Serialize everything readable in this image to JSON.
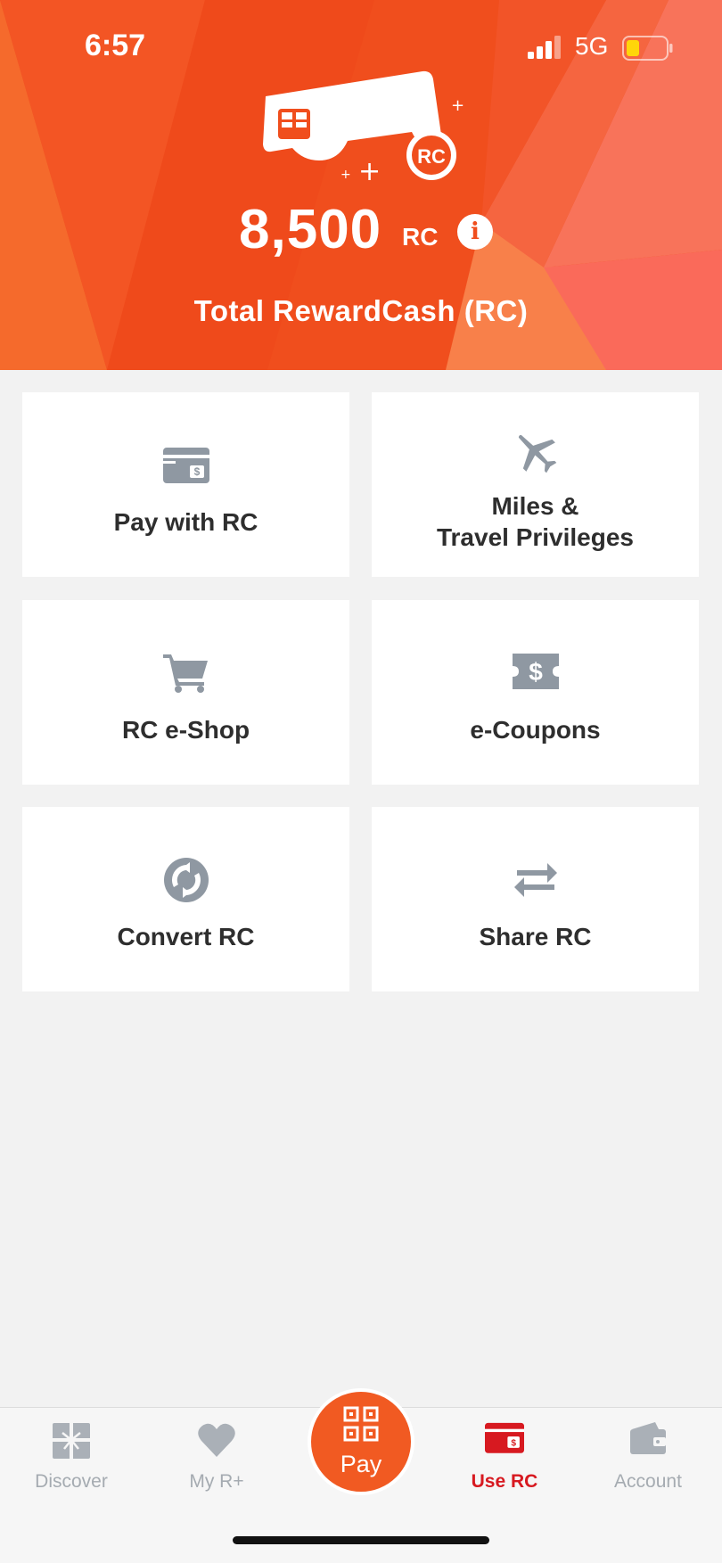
{
  "status_bar": {
    "time": "6:57",
    "network": "5G"
  },
  "header": {
    "card_badge": "RC",
    "balance_value": "8,500",
    "balance_unit": "RC",
    "info_icon_glyph": "i",
    "caption": "Total RewardCash (RC)"
  },
  "tiles": [
    {
      "label": "Pay with RC",
      "icon": "wallet-icon"
    },
    {
      "label_line1": "Miles &",
      "label_line2": "Travel Privileges",
      "icon": "airplane-icon"
    },
    {
      "label": "RC e-Shop",
      "icon": "shopping-cart-icon"
    },
    {
      "label": "e-Coupons",
      "icon": "ticket-icon"
    },
    {
      "label": "Convert RC",
      "icon": "convert-icon"
    },
    {
      "label": "Share RC",
      "icon": "swap-arrows-icon"
    }
  ],
  "tabbar": {
    "items": [
      {
        "label": "Discover",
        "icon": "gift-icon"
      },
      {
        "label": "My R+",
        "icon": "heart-icon"
      },
      {
        "label": "Pay",
        "icon": "qr-code-icon"
      },
      {
        "label": "Use RC",
        "icon": "wallet-icon",
        "active": true
      },
      {
        "label": "Account",
        "icon": "account-wallet-icon"
      }
    ]
  },
  "colors": {
    "brand_orange": "#f04e1d",
    "icon_grey": "#8f98a2",
    "active_red": "#d71920"
  }
}
